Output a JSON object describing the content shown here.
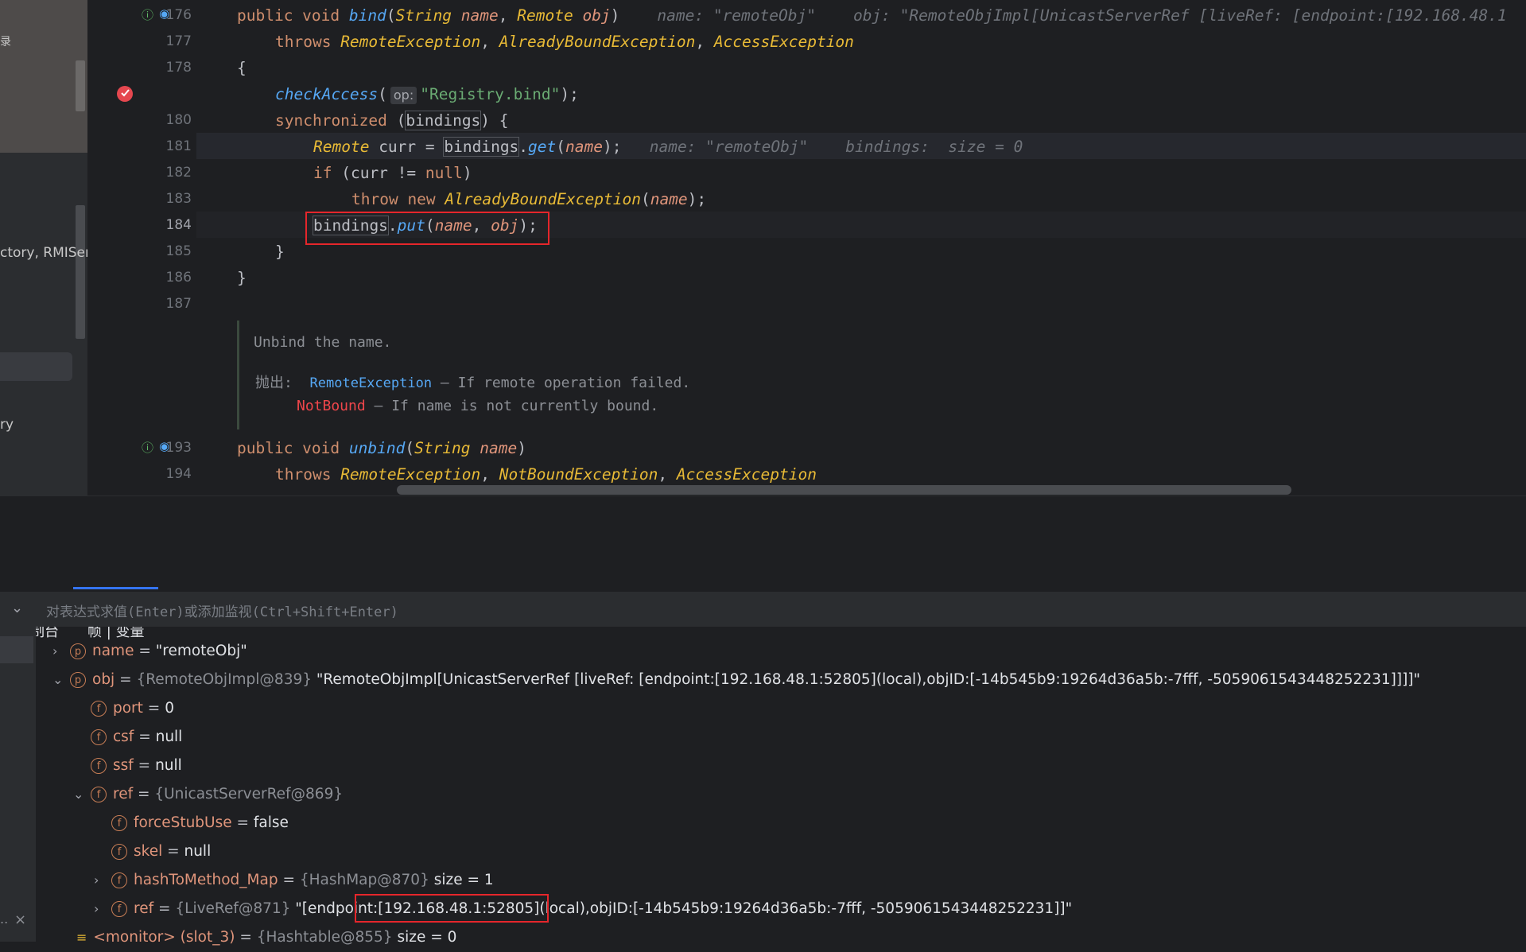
{
  "sidebar": {
    "frag1": "录",
    "frag2": "ctory, RMISer",
    "frag3": "ry"
  },
  "editor": {
    "line_numbers": [
      "176",
      "177",
      "178",
      "180",
      "181",
      "182",
      "183",
      "184",
      "185",
      "186",
      "187",
      "193",
      "194"
    ],
    "code": {
      "l176": {
        "kw": "public void ",
        "fn": "bind",
        "p1": "(",
        "t1": "String",
        "n1": " name",
        "c": ", ",
        "t2": "Remote",
        "n2": " obj",
        "p2": ")",
        "hint1": "name: \"remoteObj\"",
        "hint2": "obj: \"RemoteObjImpl[UnicastServerRef [liveRef: [endpoint:[192.168.48.1"
      },
      "l177": {
        "kw": "throws ",
        "e1": "RemoteException",
        "c1": ", ",
        "e2": "AlreadyBoundException",
        "c2": ", ",
        "e3": "AccessException"
      },
      "l178": {
        "t": "{"
      },
      "l179": {
        "fn": "checkAccess",
        "p1": "(",
        "hint": "op:",
        "str": "\"Registry.bind\"",
        "p2": ");"
      },
      "l180": {
        "kw": "synchronized",
        "p1": " (",
        "var": "bindings",
        "p2": ") {"
      },
      "l181": {
        "type": "Remote",
        "t1": " curr = ",
        "var": "bindings",
        "t2": ".",
        "fn": "get",
        "p1": "(",
        "n": "name",
        "p2": ");",
        "hint1": "name: \"remoteObj\"",
        "hint2": "bindings:  size = 0"
      },
      "l182": {
        "kw": "if",
        "t": " (curr != ",
        "kw2": "null",
        "t2": ")"
      },
      "l183": {
        "kw": "throw new ",
        "type": "AlreadyBoundException",
        "p1": "(",
        "n": "name",
        "p2": ");"
      },
      "l184": {
        "var": "bindings",
        "t1": ".",
        "fn": "put",
        "p1": "(",
        "n1": "name",
        "c": ", ",
        "n2": "obj",
        "p2": ");"
      },
      "l185": {
        "t": "}"
      },
      "l186": {
        "t": "}"
      },
      "l193": {
        "kw": "public void ",
        "fn": "unbind",
        "p1": "(",
        "t1": "String",
        "n1": " name",
        "p2": ")"
      },
      "l194": {
        "kw": "throws ",
        "e1": "RemoteException",
        "c1": ", ",
        "e2": "NotBoundException",
        "c2": ", ",
        "e3": "AccessException"
      }
    },
    "doc": {
      "summary": "Unbind the name.",
      "throws_label": "抛出:",
      "ex1": "RemoteException",
      "ex1_desc": "– If remote operation failed.",
      "ex2": "NotBound",
      "ex2_desc": "– If name is not currently bound."
    }
  },
  "debugger": {
    "tabs": [
      "控制台",
      "帧 | 变量"
    ],
    "eval_placeholder": "对表达式求值(Enter)或添加监视(Ctrl+Shift+Enter)",
    "variables": [
      {
        "arrow": "›",
        "badge": "p",
        "name": "name",
        "eq": " = ",
        "cls": "",
        "val": "\"remoteObj\""
      },
      {
        "arrow": "⌄",
        "badge": "p",
        "name": "obj",
        "eq": " = ",
        "cls": "{RemoteObjImpl@839}",
        "val": " \"RemoteObjImpl[UnicastServerRef [liveRef: [endpoint:[192.168.48.1:52805](local),objID:[-14b545b9:19264d36a5b:-7fff, -5059061543448252231]]]]\""
      },
      {
        "arrow": "",
        "badge": "f",
        "name": "port",
        "eq": " = ",
        "cls": "",
        "val": "0"
      },
      {
        "arrow": "",
        "badge": "f",
        "name": "csf",
        "eq": " = ",
        "cls": "",
        "val": "null"
      },
      {
        "arrow": "",
        "badge": "f",
        "name": "ssf",
        "eq": " = ",
        "cls": "",
        "val": "null"
      },
      {
        "arrow": "⌄",
        "badge": "f",
        "name": "ref",
        "eq": " = ",
        "cls": "{UnicastServerRef@869}",
        "val": ""
      },
      {
        "arrow": "",
        "badge": "f",
        "name": "forceStubUse",
        "eq": " = ",
        "cls": "",
        "val": "false"
      },
      {
        "arrow": "",
        "badge": "f",
        "name": "skel",
        "eq": " = ",
        "cls": "",
        "val": "null"
      },
      {
        "arrow": "›",
        "badge": "f",
        "name": "hashToMethod_Map",
        "eq": " = ",
        "cls": "{HashMap@870}",
        "val": "  size = 1"
      },
      {
        "arrow": "›",
        "badge": "f",
        "name": "ref",
        "eq": " = ",
        "cls": "{LiveRef@871}",
        "val": " \"[endpoint:[192.168.48.1:52805](local),objID:[-14b545b9:19264d36a5b:-7fff, -5059061543448252231]]\""
      },
      {
        "arrow": "",
        "badge": "",
        "name": "<monitor> (slot_3)",
        "eq": " = ",
        "cls": "{Hashtable@855}",
        "val": "  size = 0"
      }
    ],
    "close_glyph": "×",
    "dots": "..",
    "expand_glyph": "⌄"
  },
  "colors": {
    "highlight_box": "#e5262b",
    "accent": "#3574f0"
  }
}
